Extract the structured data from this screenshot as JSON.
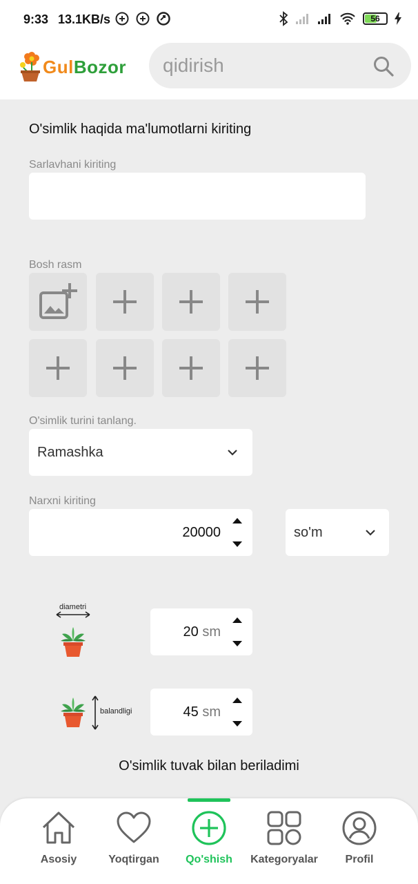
{
  "status_bar": {
    "time": "9:33",
    "speed": "13.1KB/s",
    "battery": "56",
    "battery_level": 0.56
  },
  "header": {
    "logo_part1": "Gul",
    "logo_part2": "Bozor",
    "search_placeholder": "qidirish"
  },
  "form": {
    "heading": "O'simlik haqida ma'lumotlarni kiriting",
    "title_label": "Sarlavhani kiriting",
    "title_value": "",
    "main_image_label": "Bosh rasm",
    "type_label": "O'simlik turini tanlang.",
    "type_selected": "Ramashka",
    "price_label": "Narxni kiriting",
    "price_value": "20000",
    "currency_selected": "so'm",
    "diameter_caption": "diametri",
    "diameter_value": "20",
    "diameter_unit": "sm",
    "height_caption": "balandligi",
    "height_value": "45",
    "height_unit": "sm",
    "pot_question": "O'simlik tuvak bilan beriladimi"
  },
  "bottom_nav": {
    "items": [
      {
        "label": "Asosiy",
        "icon": "home-icon"
      },
      {
        "label": "Yoqtirgan",
        "icon": "heart-icon"
      },
      {
        "label": "Qo'shish",
        "icon": "add-circle-icon",
        "active": true
      },
      {
        "label": "Kategoryalar",
        "icon": "grid-icon"
      },
      {
        "label": "Profil",
        "icon": "user-icon"
      }
    ]
  },
  "colors": {
    "accent": "#1fc35a",
    "logo_orange": "#f18a1c",
    "logo_green": "#2e9f3a",
    "background": "#ededed"
  }
}
